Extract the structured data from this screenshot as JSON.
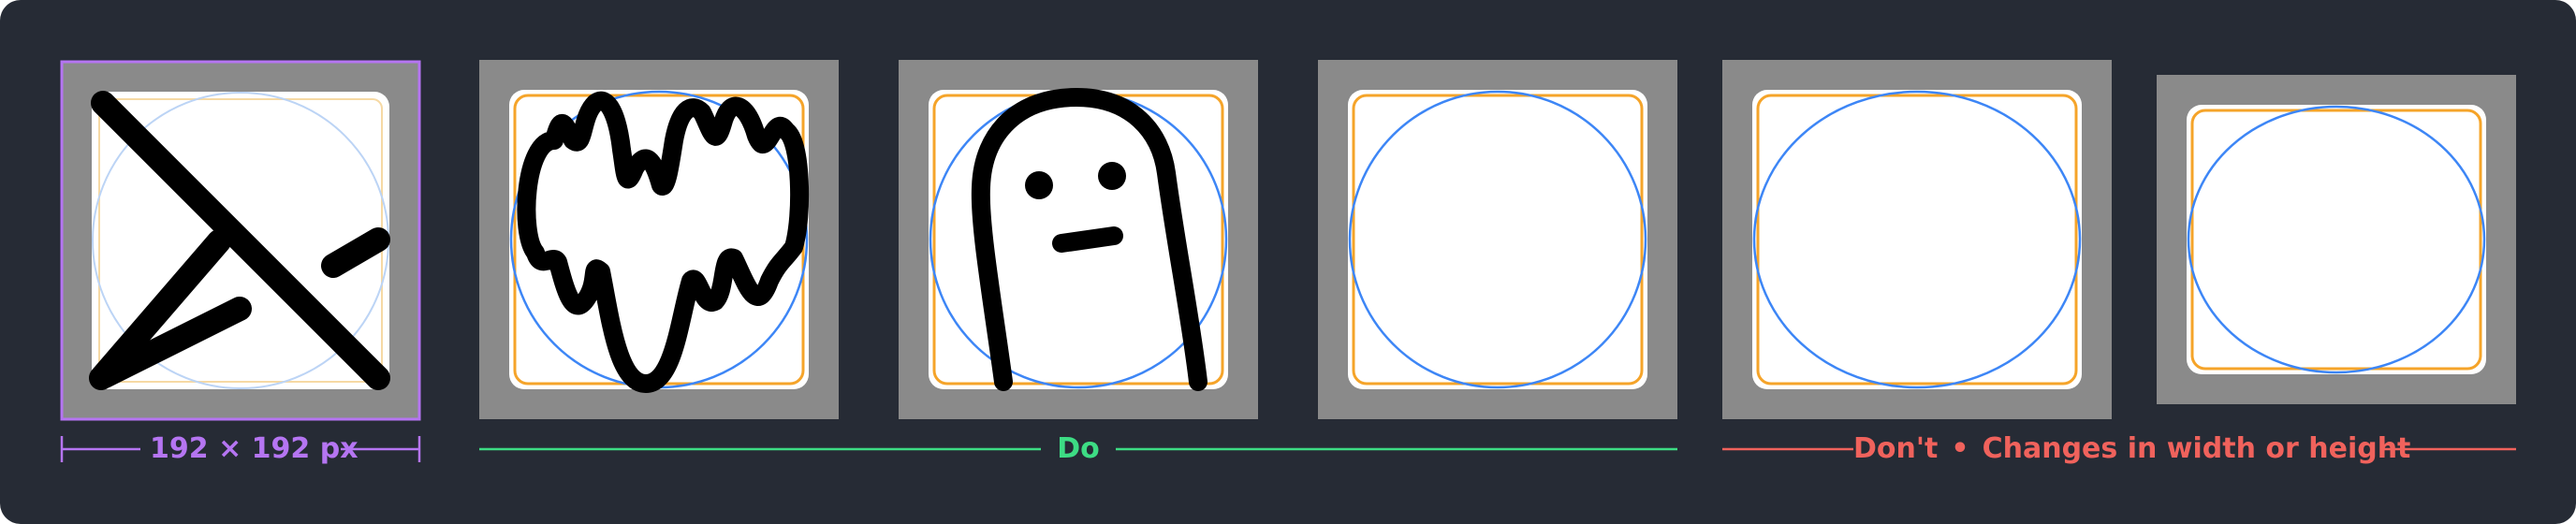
{
  "labels": {
    "size": "192 × 192 px",
    "do": "Do",
    "dont_prefix": "Don't",
    "dont_separator": "•",
    "dont_text": "Changes in width or height"
  },
  "colors": {
    "background": "#262b35",
    "tile_gray": "#8a8a8a",
    "icon_white": "#ffffff",
    "stroke_black": "#000000",
    "keyline_orange": "#f5a42a",
    "keyline_blue": "#3d86f6",
    "selection_purple": "#b575f2",
    "do_green": "#3ddc84",
    "dont_red": "#f0625c"
  },
  "tiles": [
    {
      "id": "example-line-art",
      "group": "size"
    },
    {
      "id": "example-flame-heart",
      "group": "do"
    },
    {
      "id": "example-ghost",
      "group": "do"
    },
    {
      "id": "example-plain",
      "group": "do"
    },
    {
      "id": "example-too-wide",
      "group": "dont"
    },
    {
      "id": "example-too-short",
      "group": "dont"
    }
  ]
}
